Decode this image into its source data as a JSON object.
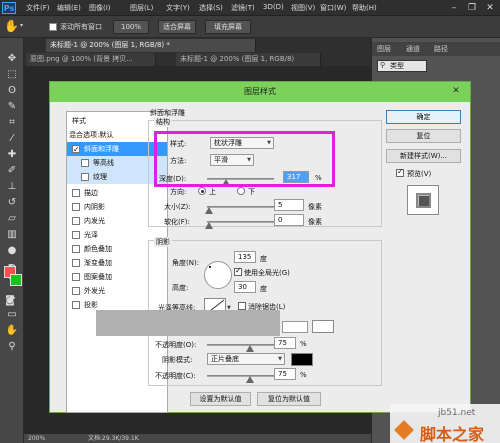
{
  "menubar": {
    "items": [
      "文件(F)",
      "编辑(E)",
      "图像(I)",
      "图层(L)",
      "文字(Y)",
      "选择(S)",
      "滤镜(T)",
      "3D(D)",
      "视图(V)",
      "窗口(W)",
      "帮助(H)"
    ]
  },
  "options": {
    "scroll_all_windows": "滚动所有窗口",
    "zoom_100": "100%",
    "fit_screen": "适合屏幕",
    "fill_screen": "填充屏幕"
  },
  "doctabs": {
    "active": "未标题-1 @ 200% (图层 1, RGB/8) *",
    "second": "原图.png @ 100% (背景 拷贝...",
    "third": "未标题-1 @ 200% (图层 1, RGB/8)"
  },
  "rightpanel": {
    "tabs": [
      "图层",
      "通道",
      "路径"
    ],
    "kind_label": "类型"
  },
  "status": {
    "zoom": "200%",
    "doc": "文档:29.3K/39.1K"
  },
  "dialog": {
    "title": "图层样式",
    "styles_header": "样式",
    "blending_options": "混合选项:默认",
    "items": [
      "斜面和浮雕",
      "等高线",
      "纹理",
      "描边",
      "内阴影",
      "内发光",
      "光泽",
      "颜色叠加",
      "渐变叠加",
      "图案叠加",
      "外发光",
      "投影"
    ],
    "section_title": "斜面和浮雕",
    "structure": {
      "header": "结构",
      "style_label": "样式:",
      "style_value": "枕状浮雕",
      "technique_label": "方法:",
      "technique_value": "平滑",
      "depth_label": "深度(D):",
      "depth_value": "317",
      "depth_unit": "%",
      "direction_label": "方向:",
      "direction_up": "上",
      "direction_down": "下",
      "size_label": "大小(Z):",
      "size_value": "5",
      "size_unit": "像素",
      "soften_label": "软化(F):",
      "soften_value": "0",
      "soften_unit": "像素"
    },
    "shading": {
      "header": "阴影",
      "angle_label": "角度(N):",
      "angle_value": "135",
      "angle_unit": "度",
      "global_light": "使用全局光(G)",
      "altitude_label": "高度:",
      "altitude_value": "30",
      "altitude_unit": "度",
      "gloss_contour_label": "光泽等高线:",
      "anti_aliased": "消除锯齿(L)",
      "highlight_opacity_label": "不透明度(O):",
      "highlight_opacity_value": "75",
      "shadow_mode_label": "阴影模式:",
      "shadow_mode_value": "正片叠底",
      "shadow_opacity_label": "不透明度(C):",
      "shadow_opacity_value": "75",
      "percent": "%"
    },
    "set_default": "设置为默认值",
    "reset_default": "复位为默认值",
    "ok": "确定",
    "reset": "复位",
    "new_style": "新建样式(W)...",
    "preview": "预览(V)"
  },
  "watermark": {
    "site": "jb51.net",
    "brand": "脚本之家"
  }
}
